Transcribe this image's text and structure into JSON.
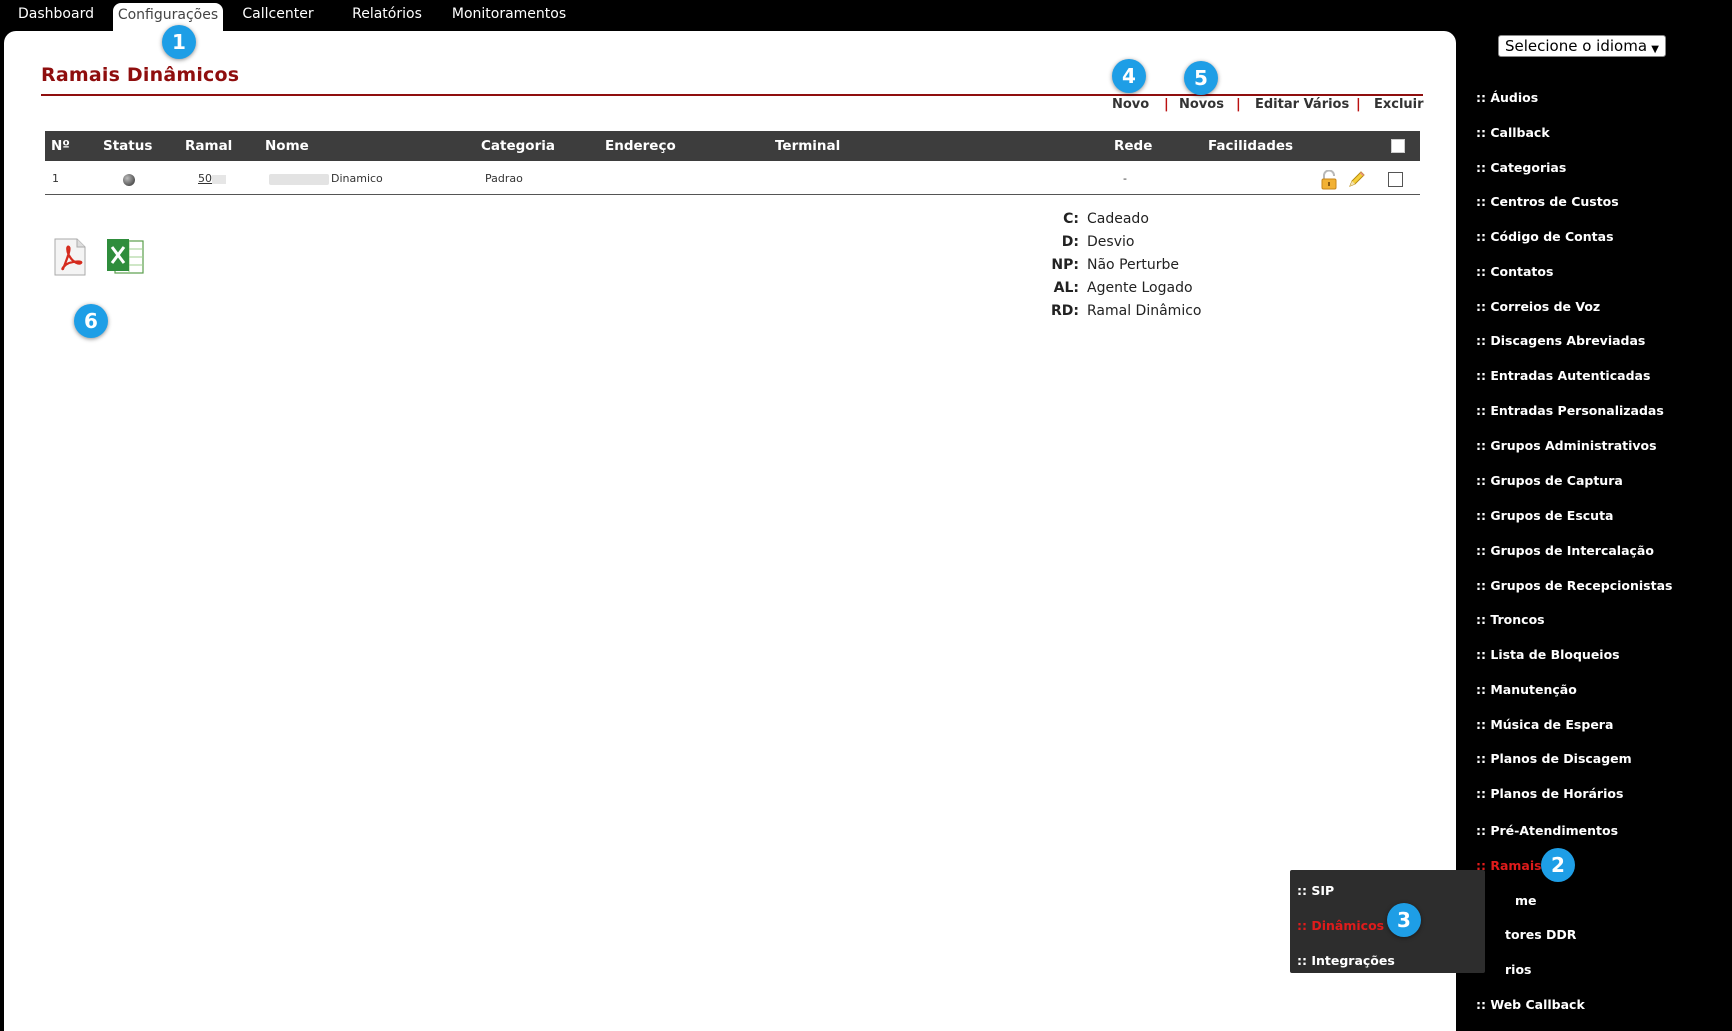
{
  "topnav": {
    "tabs": [
      {
        "label": "Dashboard"
      },
      {
        "label": "Configurações"
      },
      {
        "label": "Callcenter"
      },
      {
        "label": "Relatórios"
      },
      {
        "label": "Monitoramentos"
      }
    ],
    "active_tab": "Configurações"
  },
  "page": {
    "title": "Ramais Dinâmicos",
    "actions": {
      "novo": "Novo",
      "novos": "Novos",
      "editar_varios": "Editar Vários",
      "excluir": "Excluir",
      "separator": "|"
    }
  },
  "table": {
    "headers": {
      "num": "Nº",
      "status": "Status",
      "ramal": "Ramal",
      "nome": "Nome",
      "categoria": "Categoria",
      "endereco": "Endereço",
      "terminal": "Terminal",
      "rede": "Rede",
      "facilidades": "Facilidades"
    },
    "rows": [
      {
        "num": "1",
        "ramal": "50",
        "nome": "Dinamico",
        "categoria": "Padrao",
        "endereco": "",
        "terminal": "",
        "rede": "-"
      }
    ]
  },
  "legend": [
    {
      "key": "C:",
      "value": "Cadeado"
    },
    {
      "key": "D:",
      "value": "Desvio"
    },
    {
      "key": "NP:",
      "value": "Não Perturbe"
    },
    {
      "key": "AL:",
      "value": "Agente Logado"
    },
    {
      "key": "RD:",
      "value": "Ramal Dinâmico"
    }
  ],
  "sidebar": {
    "language_select": "Selecione o idioma",
    "items": [
      ":: Áudios",
      ":: Callback",
      ":: Categorias",
      ":: Centros de Custos",
      ":: Código de Contas",
      ":: Contatos",
      ":: Correios de Voz",
      ":: Discagens Abreviadas",
      ":: Entradas Autenticadas",
      ":: Entradas Personalizadas",
      ":: Grupos Administrativos",
      ":: Grupos de Captura",
      ":: Grupos de Escuta",
      ":: Grupos de Intercalação",
      ":: Grupos de Recepcionistas",
      ":: Troncos",
      ":: Lista de Bloqueios",
      ":: Manutenção",
      ":: Música de Espera",
      ":: Planos de Discagem",
      ":: Planos de Horários",
      ":: Pré-Atendimentos",
      ":: Ramais",
      "me",
      "tores DDR",
      "rios",
      ":: Web Callback"
    ],
    "active_item": ":: Ramais"
  },
  "submenu": {
    "items": [
      ":: SIP",
      ":: Dinâmicos",
      ":: Integrações"
    ],
    "active_item": ":: Dinâmicos"
  },
  "badges": [
    "1",
    "2",
    "3",
    "4",
    "5",
    "6"
  ],
  "colors": {
    "accent": "#8f0e0e",
    "active_menu": "#e01b1b",
    "badge": "#1e9ee6",
    "table_header": "#3d3d3d"
  },
  "icons": [
    "pdf-icon",
    "excel-icon",
    "lock-icon",
    "pencil-icon",
    "status-dot-icon",
    "chevron-down-icon"
  ]
}
